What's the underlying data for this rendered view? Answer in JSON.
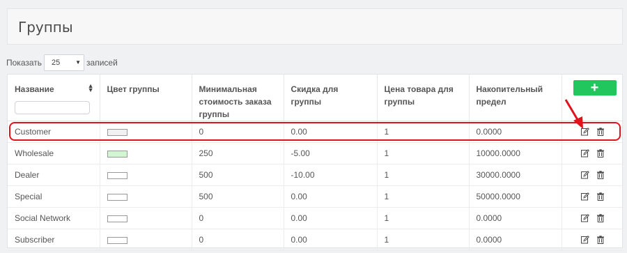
{
  "page": {
    "title": "Группы"
  },
  "length": {
    "show_label": "Показать",
    "selected": "25",
    "records_label": "записей"
  },
  "table": {
    "columns": [
      "Название",
      "Цвет группы",
      "Минимальная стоимость заказа группы",
      "Скидка для группы",
      "Цена товара для группы",
      "Накопительный предел"
    ],
    "add_button_label": "+",
    "rows": [
      {
        "name": "Customer",
        "color": "#f1f1f1",
        "min_order": "0",
        "discount": "0.00",
        "price": "1",
        "limit": "0.0000"
      },
      {
        "name": "Wholesale",
        "color": "#d2f5d2",
        "min_order": "250",
        "discount": "-5.00",
        "price": "1",
        "limit": "10000.0000"
      },
      {
        "name": "Dealer",
        "color": "#ffffff",
        "min_order": "500",
        "discount": "-10.00",
        "price": "1",
        "limit": "30000.0000"
      },
      {
        "name": "Special",
        "color": "#ffffff",
        "min_order": "500",
        "discount": "0.00",
        "price": "1",
        "limit": "50000.0000"
      },
      {
        "name": "Social Network",
        "color": "#ffffff",
        "min_order": "0",
        "discount": "0.00",
        "price": "1",
        "limit": "0.0000"
      },
      {
        "name": "Subscriber",
        "color": "#ffffff",
        "min_order": "0",
        "discount": "0.00",
        "price": "1",
        "limit": "0.0000"
      }
    ]
  },
  "colors": {
    "accent_green": "#21c65c",
    "highlight_red": "#e0121b"
  },
  "icons": {
    "edit": "edit-icon",
    "delete": "trash-icon"
  }
}
